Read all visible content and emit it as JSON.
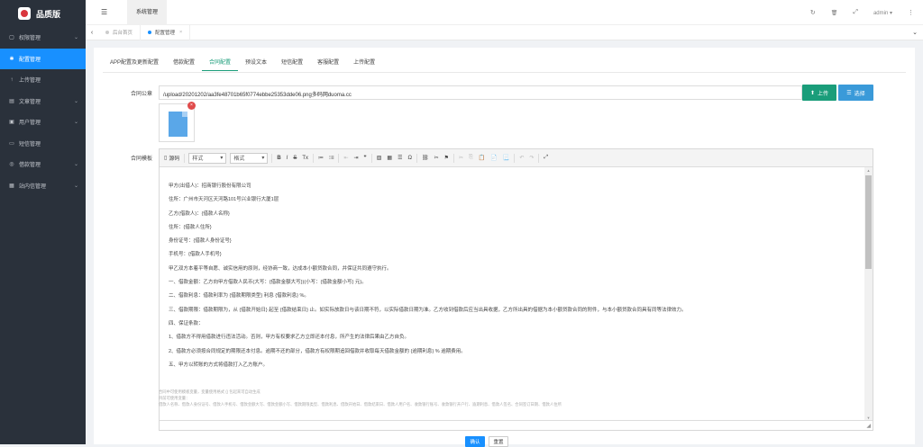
{
  "app": {
    "brand": "品质版"
  },
  "sidebar": {
    "items": [
      {
        "label": "权限管理",
        "icon": "lock-icon",
        "glyph": "▢",
        "chevron": "⌄",
        "active": false
      },
      {
        "label": "配置管理",
        "icon": "gear-icon",
        "glyph": "✱",
        "chevron": "",
        "active": true
      },
      {
        "label": "上传管理",
        "icon": "upload-icon",
        "glyph": "↑",
        "chevron": "",
        "active": false
      },
      {
        "label": "文章管理",
        "icon": "article-icon",
        "glyph": "▤",
        "chevron": "⌄",
        "active": false
      },
      {
        "label": "用户管理",
        "icon": "user-icon",
        "glyph": "▣",
        "chevron": "⌄",
        "active": false
      },
      {
        "label": "短信管理",
        "icon": "sms-icon",
        "glyph": "▭",
        "chevron": "",
        "active": false
      },
      {
        "label": "借款管理",
        "icon": "loan-icon",
        "glyph": "◎",
        "chevron": "⌄",
        "active": false
      },
      {
        "label": "站内信管理",
        "icon": "message-icon",
        "glyph": "▦",
        "chevron": "⌄",
        "active": false
      }
    ]
  },
  "header": {
    "menu_glyph": "☰",
    "system_tab": "系统管理",
    "refresh_glyph": "↻",
    "trash_glyph": "🗑",
    "fullscreen_glyph": "⤢",
    "user": "admin ▾",
    "more_glyph": "⋮"
  },
  "tabs_bar": {
    "prev_glyph": "‹",
    "next_glyph": "⌄",
    "tabs": [
      {
        "label": "后台首页",
        "active": false
      },
      {
        "label": "配置管理",
        "active": true,
        "close": "×"
      }
    ]
  },
  "config_tabs": [
    "APP配置及更新配置",
    "借款配置",
    "合同配置",
    "预设文本",
    "短信配置",
    "客服配置",
    "上传配置"
  ],
  "active_config_tab": "合同配置",
  "form": {
    "contract_seal_label": "合同公章",
    "contract_seal_value": "/upload/20201202/aa3fe48701b65f0774ebbe25353dde06.png多码网duoma.cc",
    "upload_label": "上传",
    "choose_label": "选择",
    "delete_glyph": "×",
    "contract_terms_label": "合同模板",
    "ok_label": "确认",
    "reset_label": "重置"
  },
  "editor": {
    "toolbar": {
      "source": "源码",
      "style": "样式",
      "format": "格式",
      "dropdown_glyph": "▾",
      "buttons": [
        {
          "name": "bold-button",
          "glyph": "B"
        },
        {
          "name": "italic-button",
          "glyph": "I"
        },
        {
          "name": "strikethrough-button",
          "glyph": "S"
        },
        {
          "name": "remove-format-button",
          "glyph": "Tx"
        },
        {
          "name": "numbered-list-button",
          "glyph": "≔"
        },
        {
          "name": "bulleted-list-button",
          "glyph": "⁝≡"
        },
        {
          "name": "outdent-button",
          "glyph": "⇤",
          "dim": true
        },
        {
          "name": "indent-button",
          "glyph": "⇥"
        },
        {
          "name": "blockquote-button",
          "glyph": "❞"
        },
        {
          "name": "image-button",
          "glyph": "▨"
        },
        {
          "name": "table-button",
          "glyph": "▦"
        },
        {
          "name": "horizontal-line-button",
          "glyph": "☰"
        },
        {
          "name": "special-char-button",
          "glyph": "Ω"
        },
        {
          "name": "link-button",
          "glyph": "⛓"
        },
        {
          "name": "unlink-button",
          "glyph": "✂"
        },
        {
          "name": "anchor-button",
          "glyph": "⚑"
        },
        {
          "name": "cut-button",
          "glyph": "✂",
          "dim": true
        },
        {
          "name": "copy-button",
          "glyph": "⎘",
          "dim": true
        },
        {
          "name": "paste-button",
          "glyph": "📋"
        },
        {
          "name": "paste-text-button",
          "glyph": "📄"
        },
        {
          "name": "paste-word-button",
          "glyph": "📃"
        },
        {
          "name": "undo-button",
          "glyph": "↶",
          "dim": true
        },
        {
          "name": "redo-button",
          "glyph": "↷",
          "dim": true
        },
        {
          "name": "maximize-button",
          "glyph": "⤢"
        }
      ]
    },
    "lines": [
      "甲方(出借人)：招商银行股份有限公司",
      "住所：广州市天河区天河路101号兴业银行大厦1层",
      "乙方(借款人)：{借款人名称}",
      "住所：{借款人住所}",
      "身份证号：{借款人身份证号}",
      "手机号：{借款人手机号}",
      "甲乙双方本着平等自愿、诚实信用的原则，经协商一致，达成本小额贷款合同，并保证共同遵守执行。",
      "一、借款金额：乙方向甲方借款人民币(大写：{借款金额大写})(小写：{借款金额小写} 元)。",
      "二、借款利息：借款利率为 {借款期限类型} 利息 {借款利息} %。",
      "三、借款期限：借款期限为，从 {借款开始日} 起至 {借款结束日} 止。如实际放款日与该日期不符，以实际借款日期为准。乙方收到借款后应当出具收据，乙方所出具的借据为本小额贷款合同的附件，与本小额贷款合同具有同等法律效力。",
      "四、保证条款：",
      "  1、借款方不得用借款进行违法活动。否则，甲方有权要求乙方立即还本付息，所产生的法律后果由乙方自负。",
      "  2、借款方必须按合同规定的期限还本付息。逾期不还的部分，借款方有权限期追回借款并收取每天借款金额的 {逾期利息} % 逾期费用。",
      "五、甲方以转账的方式将借款打入乙方账户。"
    ]
  },
  "hints": [
    "合同中可使用模板变量，变量使用格式 {} 包起来可自动生成",
    "目前可使用变量：",
    "借款人名称、借款人身份证号、借款人手机号、借款金额大写、借款金额小写、借款期限类型、借款利息、借款开始日、借款结束日、借款人用户名、收款银行账号、收款银行开户行、逾期利息、借款人签名、合同签订日期、借款人住所"
  ]
}
